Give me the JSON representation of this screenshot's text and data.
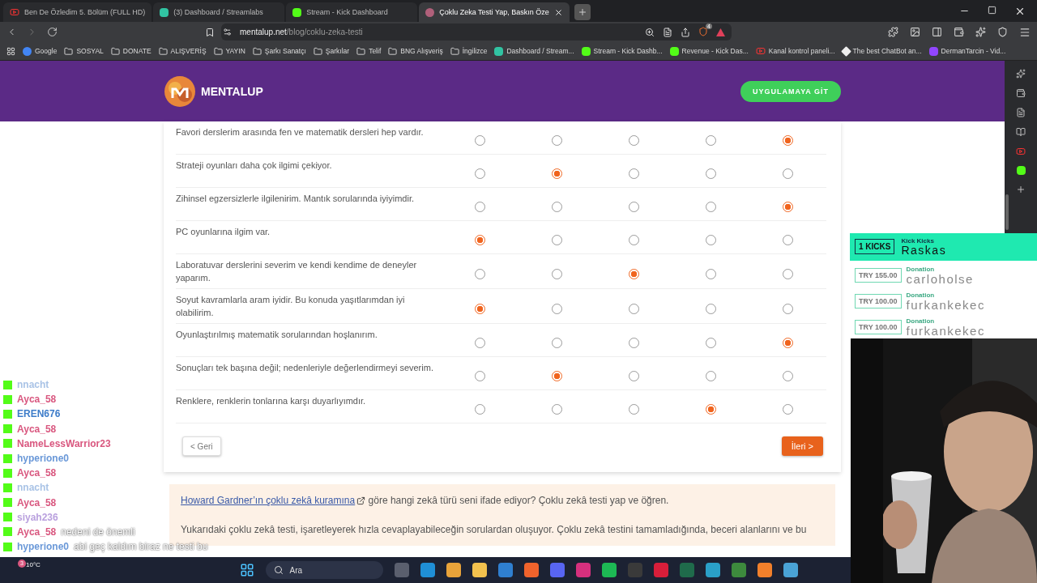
{
  "browser": {
    "tabs": [
      {
        "title": "Ben De Özledim 5. Bölüm (FULL HD)",
        "kind": "video",
        "selected": false
      },
      {
        "title": "(3) Dashboard / Streamlabs",
        "kind": "streamlabs",
        "selected": false
      },
      {
        "title": "Stream - Kick Dashboard",
        "kind": "kick",
        "selected": false
      },
      {
        "title": "Çoklu Zeka Testi Yap, Baskın Öze",
        "kind": "mentalup",
        "selected": true
      }
    ],
    "address": {
      "host": "mentalup.net",
      "path": "/blog/coklu-zeka-testi"
    },
    "shield_count": "4",
    "bookmarks": [
      {
        "label": "Google",
        "kind": "google"
      },
      {
        "label": "SOSYAL",
        "kind": "folder"
      },
      {
        "label": "DONATE",
        "kind": "folder"
      },
      {
        "label": "ALIŞVERİŞ",
        "kind": "folder"
      },
      {
        "label": "YAYIN",
        "kind": "folder"
      },
      {
        "label": "Şarkı Sanatçı",
        "kind": "folder"
      },
      {
        "label": "Şarkılar",
        "kind": "folder"
      },
      {
        "label": "Telif",
        "kind": "folder"
      },
      {
        "label": "BNG Alışveriş",
        "kind": "folder"
      },
      {
        "label": "İngilizce",
        "kind": "folder"
      },
      {
        "label": "Dashboard / Stream...",
        "kind": "streamlabs"
      },
      {
        "label": "Stream - Kick Dashb...",
        "kind": "kick"
      },
      {
        "label": "Revenue - Kick Das...",
        "kind": "kick"
      },
      {
        "label": "Kanal kontrol paneli...",
        "kind": "video"
      },
      {
        "label": "The best ChatBot an...",
        "kind": "bot"
      },
      {
        "label": "DermanTarcin - Vid...",
        "kind": "twitch"
      }
    ]
  },
  "header": {
    "brand": "MENTALUP",
    "button": "UYGULAMAYA GİT"
  },
  "questions": [
    {
      "text": "Favori derslerim arasında fen ve matematik dersleri hep vardır.",
      "options": [
        {
          "selected": false
        },
        {
          "selected": false
        },
        {
          "selected": false
        },
        {
          "selected": false
        },
        {
          "selected": true
        }
      ]
    },
    {
      "text": "Strateji oyunları daha çok ilgimi çekiyor.",
      "options": [
        {
          "selected": false
        },
        {
          "selected": true
        },
        {
          "selected": false
        },
        {
          "selected": false
        },
        {
          "selected": false
        }
      ]
    },
    {
      "text": "Zihinsel egzersizlerle ilgilenirim. Mantık sorularında iyiyimdir.",
      "options": [
        {
          "selected": false
        },
        {
          "selected": false
        },
        {
          "selected": false
        },
        {
          "selected": false
        },
        {
          "selected": true
        }
      ]
    },
    {
      "text": "PC oyunlarına ilgim var.",
      "options": [
        {
          "selected": true
        },
        {
          "selected": false
        },
        {
          "selected": false
        },
        {
          "selected": false
        },
        {
          "selected": false
        }
      ]
    },
    {
      "text": "Laboratuvar derslerini severim ve kendi kendime de deneyler yaparım.",
      "options": [
        {
          "selected": false
        },
        {
          "selected": false
        },
        {
          "selected": true
        },
        {
          "selected": false
        },
        {
          "selected": false
        }
      ]
    },
    {
      "text": "Soyut kavramlarla aram iyidir. Bu konuda yaşıtlarımdan iyi olabilirim.",
      "options": [
        {
          "selected": true
        },
        {
          "selected": false
        },
        {
          "selected": false
        },
        {
          "selected": false
        },
        {
          "selected": false
        }
      ]
    },
    {
      "text": "Oyunlaştırılmış matematik sorularından hoşlanırım.",
      "options": [
        {
          "selected": false
        },
        {
          "selected": false
        },
        {
          "selected": false
        },
        {
          "selected": false
        },
        {
          "selected": true
        }
      ]
    },
    {
      "text": "Sonuçları tek başına değil; nedenleriyle değerlendirmeyi severim.",
      "options": [
        {
          "selected": false
        },
        {
          "selected": true
        },
        {
          "selected": false
        },
        {
          "selected": false
        },
        {
          "selected": false
        }
      ]
    },
    {
      "text": "Renklere, renklerin tonlarına karşı duyarlıyımdır.",
      "options": [
        {
          "selected": false
        },
        {
          "selected": false
        },
        {
          "selected": false
        },
        {
          "selected": true
        },
        {
          "selected": false
        }
      ]
    }
  ],
  "nav": {
    "back": "< Geri",
    "next": "İleri >"
  },
  "info": {
    "link": "Howard Gardner’ın çoklu zekâ kuramına",
    "after_link": "göre hangi zekâ türü seni ifade ediyor? Çoklu zekâ testi yap ve öğren.",
    "paragraph": "Yukarıdaki çoklu zekâ testi, işaretleyerek hızla cevaplayabileceğin sorulardan oluşuyor. Çoklu zekâ testini tamamladığında, beceri alanlarını ve bu"
  },
  "chat": [
    {
      "user": "nnacht",
      "color": "#a9c3e6"
    },
    {
      "user": "Ayca_58",
      "color": "#d9577f"
    },
    {
      "user": "EREN676",
      "color": "#3d7cc9"
    },
    {
      "user": "Ayca_58",
      "color": "#d9577f"
    },
    {
      "user": "NameLessWarrior23",
      "color": "#d9577f"
    },
    {
      "user": "hyperione0",
      "color": "#6a98d8"
    },
    {
      "user": "Ayca_58",
      "color": "#d9577f"
    },
    {
      "user": "nnacht",
      "color": "#a9c3e6"
    },
    {
      "user": "Ayca_58",
      "color": "#d9577f"
    },
    {
      "user": "siyah236",
      "color": "#b9a0de"
    },
    {
      "user": "Ayca_58",
      "color": "#d9577f",
      "message": "nedeni de önemli"
    },
    {
      "user": "hyperione0",
      "color": "#6a98d8",
      "message": "abi geç kaldım biraz ne testi bu"
    }
  ],
  "alerts": {
    "top": {
      "amount": "1 KICKS",
      "label": "Kick Kicks",
      "name": "Raskas"
    },
    "items": [
      {
        "amount": "TRY 155.00",
        "label": "Donation",
        "name": "carloholse"
      },
      {
        "amount": "TRY 100.00",
        "label": "Donation",
        "name": "furkankekec"
      },
      {
        "amount": "TRY 100.00",
        "label": "Donation",
        "name": "furkankekec"
      }
    ]
  },
  "taskbar": {
    "weather": "10°C",
    "weather_badge": "3",
    "search": "Ara",
    "apps": [
      {
        "color": "#5a5f6e"
      },
      {
        "color": "#1f8fd6"
      },
      {
        "color": "#e8a33a"
      },
      {
        "color": "#f2c14e"
      },
      {
        "color": "#2f7fd0"
      },
      {
        "color": "#f0632c"
      },
      {
        "color": "#5865f2"
      },
      {
        "color": "#d6307e"
      },
      {
        "color": "#1db954"
      },
      {
        "color": "#3a3a3a"
      },
      {
        "color": "#d81e3a"
      },
      {
        "color": "#1f6b4b"
      },
      {
        "color": "#2aa0c8"
      },
      {
        "color": "#3d8a3d"
      },
      {
        "color": "#f2802b"
      },
      {
        "color": "#4aa3d6"
      }
    ]
  }
}
